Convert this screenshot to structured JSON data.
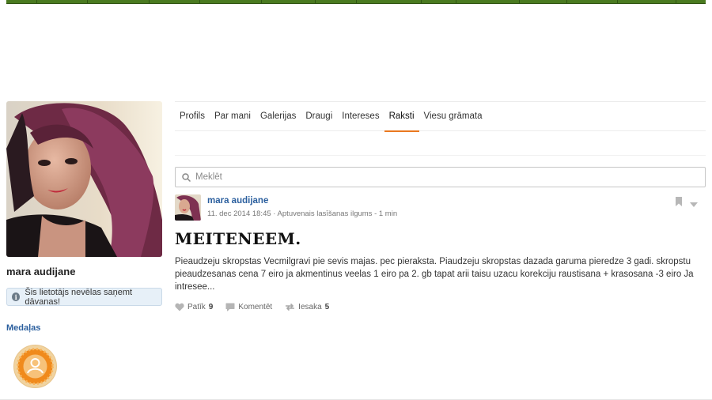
{
  "profile": {
    "username": "mara audijane",
    "gift_notice": "Šis lietotājs nevēlas saņemt dāvanas!",
    "medals_title": "Medaļas"
  },
  "tabs": [
    {
      "label": "Profils"
    },
    {
      "label": "Par mani"
    },
    {
      "label": "Galerijas"
    },
    {
      "label": "Draugi"
    },
    {
      "label": "Intereses"
    },
    {
      "label": "Raksti",
      "active": true
    },
    {
      "label": "Viesu grāmata"
    }
  ],
  "search": {
    "placeholder": "Meklēt"
  },
  "post": {
    "author": "mara audijane",
    "meta": "11. dec 2014 18:45 · Aptuvenais lasīšanas ilgums - 1 min",
    "title": "MEITENEEM.",
    "body": "Pieaudzeju skropstas Vecmilgravi pie sevis majas. pec pieraksta. Piaudzeju skropstas dazada garuma pieredze 3 gadi. skropstu pieaudzesanas cena 7 eiro ja akmentinus veelas 1 eiro pa 2. gb tapat arii taisu uzacu korekciju raustisana + krasosana -3 eiro Ja intresee...",
    "actions": {
      "like_label": "Patīk",
      "like_count": "9",
      "comment_label": "Komentēt",
      "share_label": "Iesaka",
      "share_count": "5"
    }
  },
  "colors": {
    "accent": "#e9781f",
    "link": "#2b5f9e",
    "topbar": "#4a7a20"
  },
  "icons": [
    "search-icon",
    "bookmark-icon",
    "chevron-down-icon",
    "heart-icon",
    "comment-icon",
    "share-icon",
    "info-icon",
    "medal-icon"
  ]
}
